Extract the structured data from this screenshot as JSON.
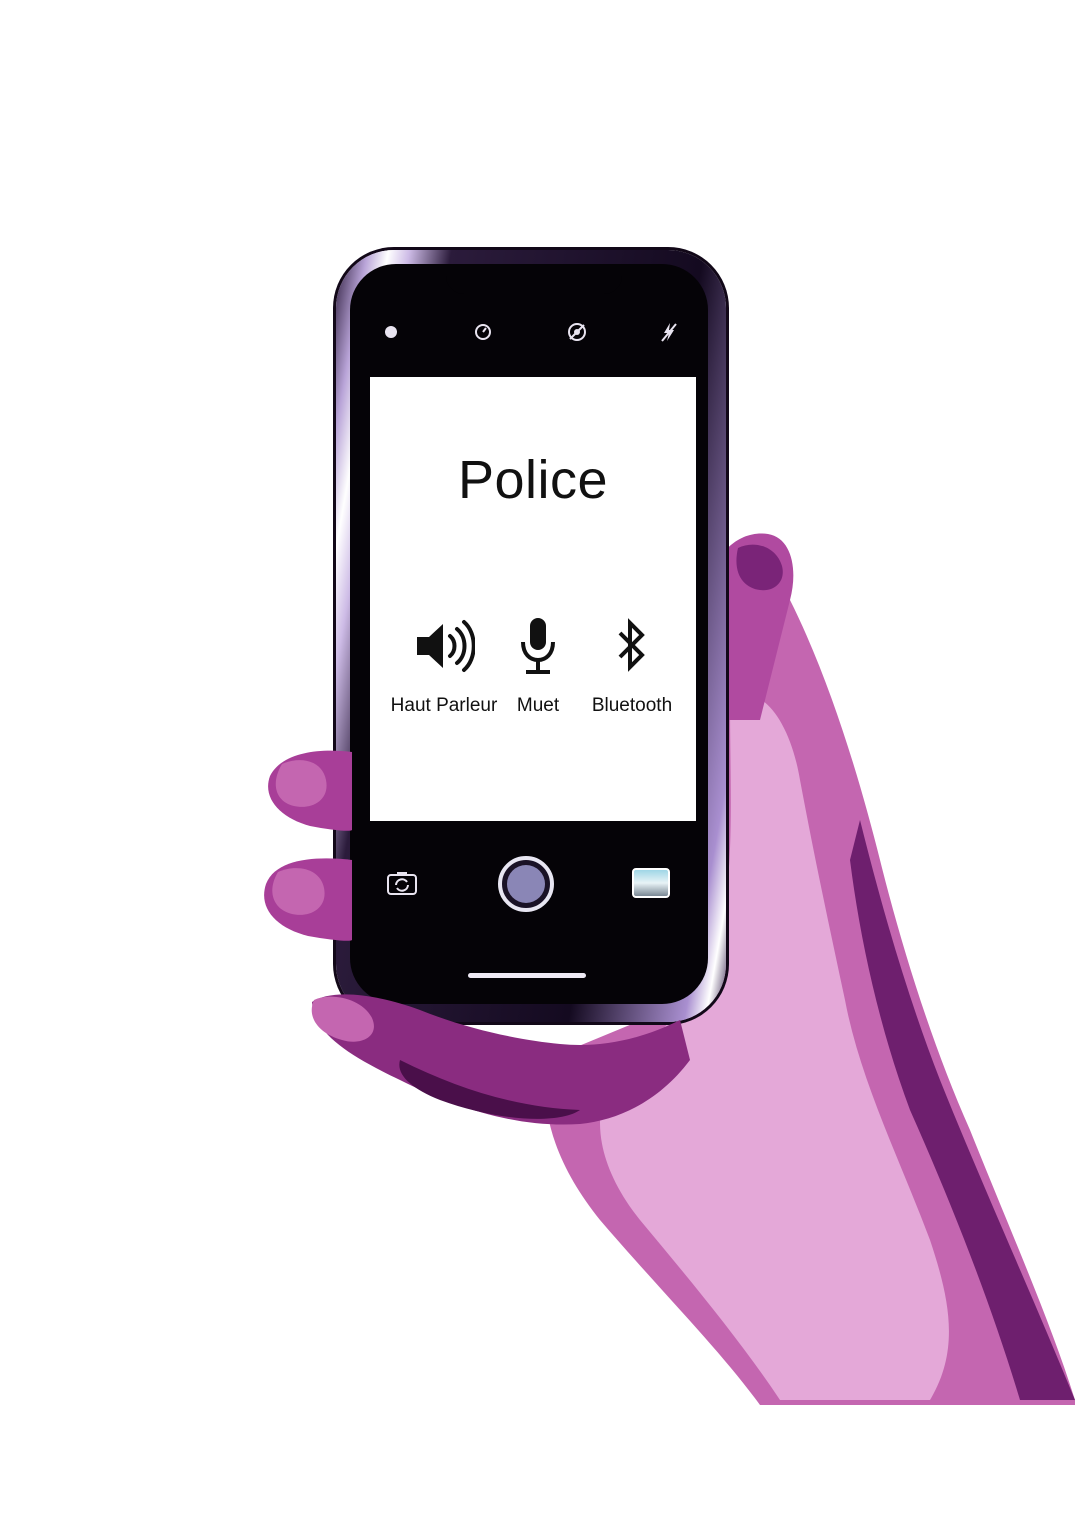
{
  "call_screen": {
    "caller_name": "Police",
    "controls": [
      {
        "label": "Haut Parleur",
        "icon": "speaker-icon"
      },
      {
        "label": "Muet",
        "icon": "microphone-icon"
      },
      {
        "label": "Bluetooth",
        "icon": "bluetooth-icon"
      }
    ]
  },
  "camera_bar": {
    "top_icons": [
      "flash-icon",
      "timer-icon",
      "live-off-icon",
      "flash-off-icon"
    ],
    "bottom_icons": [
      "camera-flip-icon",
      "shutter-icon",
      "gallery-thumbnail"
    ]
  },
  "colors": {
    "skin_light": "#e4a8d8",
    "skin_mid": "#c466b0",
    "skin_dark": "#6e1f6e",
    "phone_body": "#050307"
  }
}
